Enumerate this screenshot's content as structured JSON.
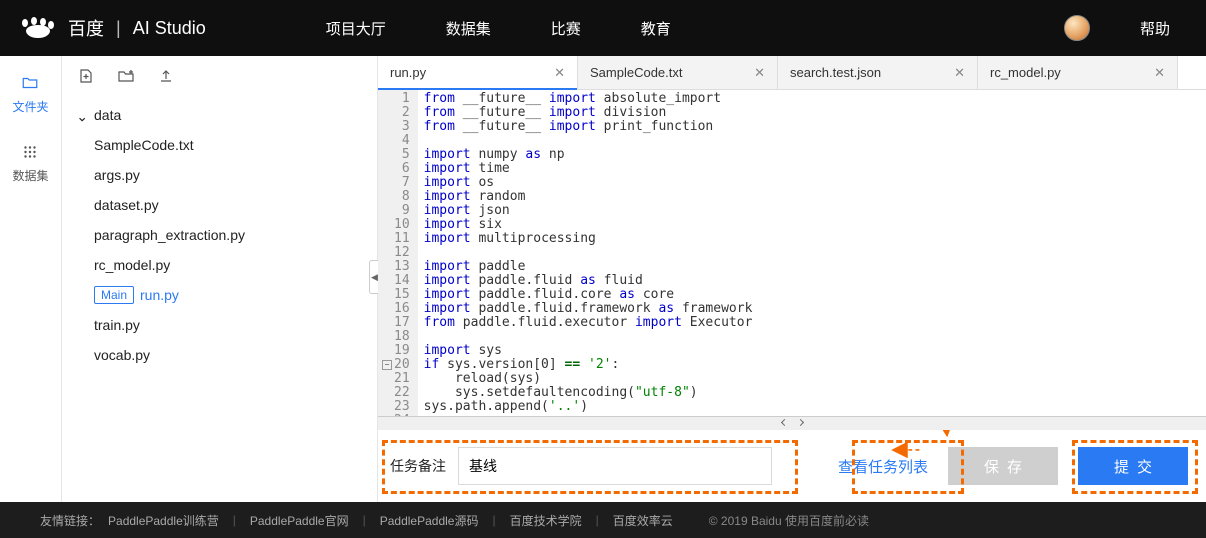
{
  "header": {
    "brand_baidu": "百度",
    "brand_studio": "AI Studio",
    "nav": {
      "lobby": "项目大厅",
      "datasets": "数据集",
      "contests": "比赛",
      "edu": "教育"
    },
    "help": "帮助"
  },
  "rail": {
    "files_label": "文件夹",
    "dataset_label": "数据集"
  },
  "tree": {
    "folder_data": "data",
    "items": [
      "SampleCode.txt",
      "args.py",
      "dataset.py",
      "paragraph_extraction.py",
      "rc_model.py",
      "run.py",
      "train.py",
      "vocab.py"
    ],
    "main_badge": "Main"
  },
  "tabs": {
    "t0": "run.py",
    "t1": "SampleCode.txt",
    "t2": "search.test.json",
    "t3": "rc_model.py"
  },
  "code": {
    "lines": [
      [
        [
          "from",
          "kw-from"
        ],
        [
          " __future__ ",
          ""
        ],
        [
          "import",
          "kw-import"
        ],
        [
          " absolute_import",
          ""
        ]
      ],
      [
        [
          "from",
          "kw-from"
        ],
        [
          " __future__ ",
          ""
        ],
        [
          "import",
          "kw-import"
        ],
        [
          " division",
          ""
        ]
      ],
      [
        [
          "from",
          "kw-from"
        ],
        [
          " __future__ ",
          ""
        ],
        [
          "import",
          "kw-import"
        ],
        [
          " print_function",
          ""
        ]
      ],
      [],
      [
        [
          "import",
          "kw-import"
        ],
        [
          " numpy ",
          ""
        ],
        [
          "as",
          "kw-as"
        ],
        [
          " np",
          ""
        ]
      ],
      [
        [
          "import",
          "kw-import"
        ],
        [
          " time",
          ""
        ]
      ],
      [
        [
          "import",
          "kw-import"
        ],
        [
          " os",
          ""
        ]
      ],
      [
        [
          "import",
          "kw-import"
        ],
        [
          " random",
          ""
        ]
      ],
      [
        [
          "import",
          "kw-import"
        ],
        [
          " json",
          ""
        ]
      ],
      [
        [
          "import",
          "kw-import"
        ],
        [
          " six",
          ""
        ]
      ],
      [
        [
          "import",
          "kw-import"
        ],
        [
          " multiprocessing",
          ""
        ]
      ],
      [],
      [
        [
          "import",
          "kw-import"
        ],
        [
          " paddle",
          ""
        ]
      ],
      [
        [
          "import",
          "kw-import"
        ],
        [
          " paddle.fluid ",
          ""
        ],
        [
          "as",
          "kw-as"
        ],
        [
          " fluid",
          ""
        ]
      ],
      [
        [
          "import",
          "kw-import"
        ],
        [
          " paddle.fluid.core ",
          ""
        ],
        [
          "as",
          "kw-as"
        ],
        [
          " core",
          ""
        ]
      ],
      [
        [
          "import",
          "kw-import"
        ],
        [
          " paddle.fluid.framework ",
          ""
        ],
        [
          "as",
          "kw-as"
        ],
        [
          " framework",
          ""
        ]
      ],
      [
        [
          "from",
          "kw-from"
        ],
        [
          " paddle.fluid.executor ",
          ""
        ],
        [
          "import",
          "kw-import"
        ],
        [
          " Executor",
          ""
        ]
      ],
      [],
      [
        [
          "import",
          "kw-import"
        ],
        [
          " sys",
          ""
        ]
      ],
      [
        [
          "if",
          "kw-if"
        ],
        [
          " sys.version[0] ",
          ""
        ],
        [
          "==",
          "kw-sym"
        ],
        [
          " ",
          ""
        ],
        [
          "'2'",
          "str"
        ],
        [
          ":",
          ""
        ]
      ],
      [
        [
          "    reload(sys)",
          ""
        ]
      ],
      [
        [
          "    sys.setdefaultencoding(",
          ""
        ],
        [
          "\"utf-8\"",
          "str"
        ],
        [
          ")",
          ""
        ]
      ],
      [
        [
          "sys.path.append(",
          ""
        ],
        [
          "'..'",
          "str"
        ],
        [
          ")",
          ""
        ]
      ],
      []
    ]
  },
  "actionbar": {
    "task_label": "任务备注",
    "task_value": "基线",
    "view_tasks": "查看任务列表",
    "save": "保存",
    "submit": "提交"
  },
  "footer": {
    "lead": "友情链接：",
    "l0": "PaddlePaddle训练营",
    "l1": "PaddlePaddle官网",
    "l2": "PaddlePaddle源码",
    "l3": "百度技术学院",
    "l4": "百度效率云",
    "copy": "© 2019 Baidu 使用百度前必读"
  }
}
